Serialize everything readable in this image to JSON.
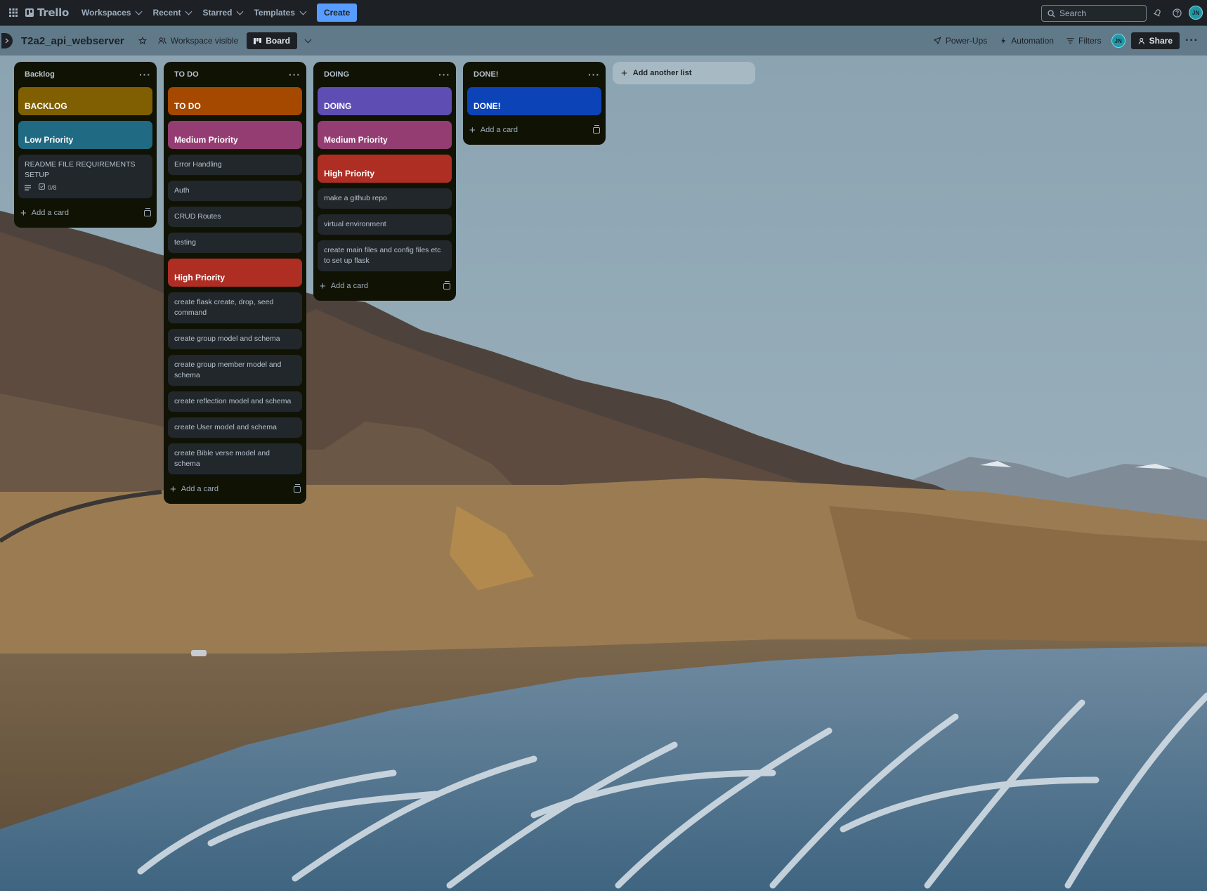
{
  "topnav": {
    "logo_text": "Trello",
    "menus": [
      {
        "label": "Workspaces"
      },
      {
        "label": "Recent"
      },
      {
        "label": "Starred"
      },
      {
        "label": "Templates"
      }
    ],
    "create_label": "Create",
    "search_placeholder": "Search",
    "avatar_initials": "JN"
  },
  "board": {
    "title": "T2a2_api_webserver",
    "visibility_label": "Workspace visible",
    "view_label": "Board",
    "powerups_label": "Power-Ups",
    "automation_label": "Automation",
    "filters_label": "Filters",
    "share_label": "Share",
    "member_initials": "JN"
  },
  "lists": [
    {
      "title": "Backlog",
      "cards": [
        {
          "kind": "label",
          "text": "BACKLOG",
          "color": "#7f5f01"
        },
        {
          "kind": "label",
          "text": "Low Priority",
          "color": "#206a83"
        },
        {
          "kind": "card",
          "text": "README FILE REQUIREMENTS SETUP",
          "checklist": "0/8",
          "has_description": true
        }
      ],
      "add_card_label": "Add a card"
    },
    {
      "title": "TO DO",
      "cards": [
        {
          "kind": "label",
          "text": "TO DO",
          "color": "#a54800"
        },
        {
          "kind": "label",
          "text": "Medium Priority",
          "color": "#943d73"
        },
        {
          "kind": "card",
          "text": "Error Handling"
        },
        {
          "kind": "card",
          "text": "Auth"
        },
        {
          "kind": "card",
          "text": "CRUD Routes"
        },
        {
          "kind": "card",
          "text": "testing"
        },
        {
          "kind": "label",
          "text": "High Priority",
          "color": "#ae2e24"
        },
        {
          "kind": "card",
          "text": "create flask create, drop, seed command"
        },
        {
          "kind": "card",
          "text": "create group model and schema"
        },
        {
          "kind": "card",
          "text": "create group member model and schema"
        },
        {
          "kind": "card",
          "text": "create reflection model and schema"
        },
        {
          "kind": "card",
          "text": "create User model and schema"
        },
        {
          "kind": "card",
          "text": "create Bible verse model and schema"
        }
      ],
      "add_card_label": "Add a card"
    },
    {
      "title": "DOING",
      "cards": [
        {
          "kind": "label",
          "text": "DOING",
          "color": "#5e4db2"
        },
        {
          "kind": "label",
          "text": "Medium Priority",
          "color": "#943d73"
        },
        {
          "kind": "label",
          "text": "High Priority",
          "color": "#ae2e24"
        },
        {
          "kind": "card",
          "text": "make a github repo"
        },
        {
          "kind": "card",
          "text": "virtual environment"
        },
        {
          "kind": "card",
          "text": "create main files and config files etc to set up flask"
        }
      ],
      "add_card_label": "Add a card"
    },
    {
      "title": "DONE!",
      "cards": [
        {
          "kind": "label",
          "text": "DONE!",
          "color": "#0c44b8"
        }
      ],
      "add_card_label": "Add a card"
    }
  ],
  "add_list_label": "Add another list"
}
